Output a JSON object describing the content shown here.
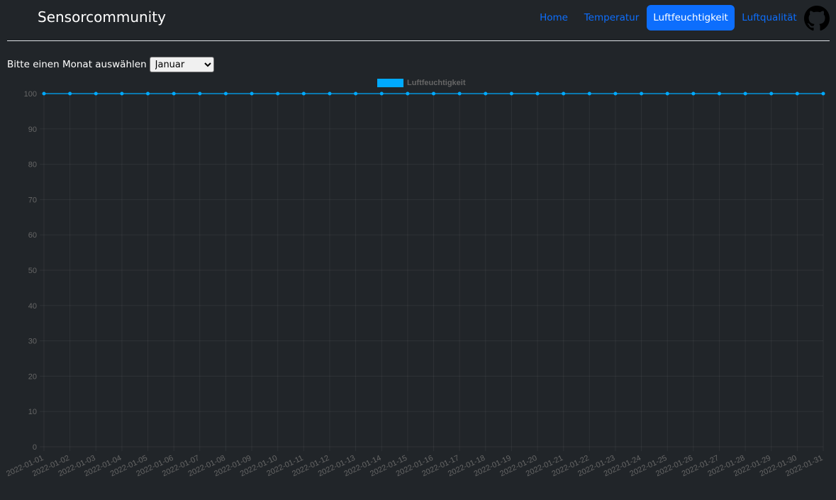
{
  "navbar": {
    "brand": "Sensorcommunity",
    "links": [
      {
        "label": "Home",
        "active": false
      },
      {
        "label": "Temperatur",
        "active": false
      },
      {
        "label": "Luftfeuchtigkeit",
        "active": true
      },
      {
        "label": "Luftqualität",
        "active": false
      }
    ],
    "github_icon": "github-icon"
  },
  "month_picker": {
    "label": "Bitte einen Monat auswählen",
    "selected": "Januar"
  },
  "colors": {
    "background": "#212529",
    "accent": "#0d6efd",
    "series": "#00aaff"
  },
  "chart_data": {
    "type": "line",
    "legend_position": "top",
    "grid": true,
    "ylim": [
      0,
      100
    ],
    "yticks": [
      0,
      10,
      20,
      30,
      40,
      50,
      60,
      70,
      80,
      90,
      100
    ],
    "x": [
      "2022-01-01",
      "2022-01-02",
      "2022-01-03",
      "2022-01-04",
      "2022-01-05",
      "2022-01-06",
      "2022-01-07",
      "2022-01-08",
      "2022-01-09",
      "2022-01-10",
      "2022-01-11",
      "2022-01-12",
      "2022-01-13",
      "2022-01-14",
      "2022-01-15",
      "2022-01-16",
      "2022-01-17",
      "2022-01-18",
      "2022-01-19",
      "2022-01-20",
      "2022-01-21",
      "2022-01-22",
      "2022-01-23",
      "2022-01-24",
      "2022-01-25",
      "2022-01-26",
      "2022-01-27",
      "2022-01-28",
      "2022-01-29",
      "2022-01-30",
      "2022-01-31"
    ],
    "series": [
      {
        "name": "Luftfeuchtigkeit",
        "color": "#00aaff",
        "values": [
          100,
          100,
          100,
          100,
          100,
          100,
          100,
          100,
          100,
          100,
          100,
          100,
          100,
          100,
          100,
          100,
          100,
          100,
          100,
          100,
          100,
          100,
          100,
          100,
          100,
          100,
          100,
          100,
          100,
          100,
          100
        ]
      }
    ]
  }
}
